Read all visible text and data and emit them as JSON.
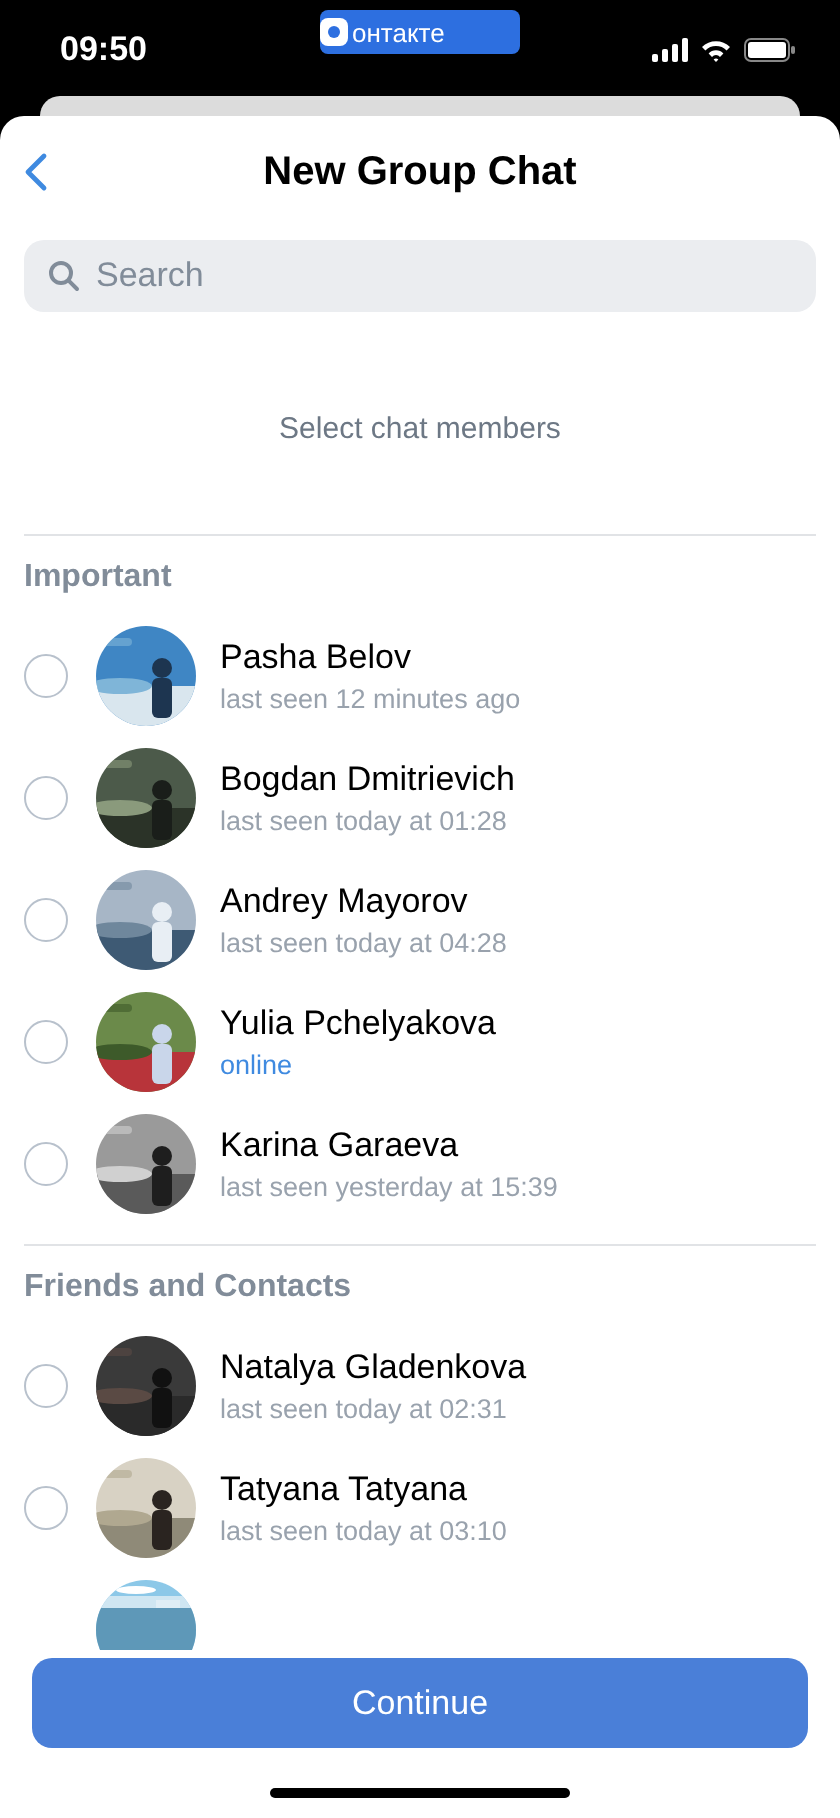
{
  "status_bar": {
    "time": "09:50",
    "app_pill": "онтакте"
  },
  "header": {
    "title": "New Group Chat"
  },
  "search": {
    "placeholder": "Search"
  },
  "prompt": "Select chat members",
  "sections": [
    {
      "title": "Important",
      "contacts": [
        {
          "kind": "contact",
          "name": "Pasha Belov",
          "status": "last seen 12 minutes ago",
          "online": false,
          "checked": false
        },
        {
          "kind": "contact",
          "name": "Bogdan Dmitrievich",
          "status": "last seen today at 01:28",
          "online": false,
          "checked": false
        },
        {
          "kind": "contact",
          "name": "Andrey Mayorov",
          "status": "last seen today at 04:28",
          "online": false,
          "checked": false
        },
        {
          "kind": "contact",
          "name": "Yulia Pchelyakova",
          "status": "online",
          "online": true,
          "checked": false
        },
        {
          "kind": "contact",
          "name": "Karina Garaeva",
          "status": "last seen yesterday at 15:39",
          "online": false,
          "checked": false
        }
      ]
    },
    {
      "title": "Friends and Contacts",
      "contacts": [
        {
          "kind": "contact",
          "name": "Natalya Gladenkova",
          "status": "last seen today at 02:31",
          "online": false,
          "checked": false
        },
        {
          "kind": "contact",
          "name": "Tatyana Tatyana",
          "status": "last seen today at 03:10",
          "online": false,
          "checked": false
        },
        {
          "kind": "picture"
        }
      ]
    }
  ],
  "button": "Continue"
}
